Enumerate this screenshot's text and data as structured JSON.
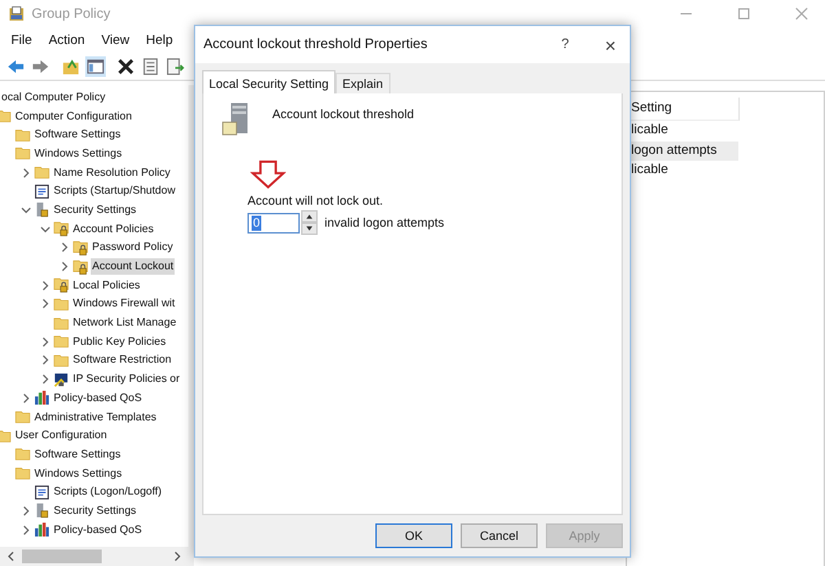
{
  "window": {
    "title": "Group Policy"
  },
  "menu": [
    "File",
    "Action",
    "View",
    "Help"
  ],
  "toolbar": [
    {
      "kind": "back"
    },
    {
      "kind": "forward"
    },
    {
      "kind": "up"
    },
    {
      "kind": "tree",
      "pressed": true
    },
    {
      "kind": "delete"
    },
    {
      "kind": "properties"
    },
    {
      "kind": "export"
    }
  ],
  "tree": [
    {
      "label": "ocal Computer Policy",
      "selected": false,
      "children": [
        {
          "label": "Computer Configuration",
          "kind": "folder",
          "selected": false,
          "children": [
            {
              "label": "Software Settings",
              "kind": "folder",
              "selected": false
            },
            {
              "label": "Windows Settings",
              "kind": "folder",
              "selected": false,
              "children": [
                {
                  "label": "Name Resolution Policy",
                  "kind": "folder",
                  "expanded": false,
                  "selected": false
                },
                {
                  "label": "Scripts (Startup/Shutdow",
                  "kind": "script",
                  "selected": false
                },
                {
                  "label": "Security Settings",
                  "kind": "security",
                  "expanded": true,
                  "selected": false,
                  "children": [
                    {
                      "label": "Account Policies",
                      "kind": "locked",
                      "expanded": true,
                      "selected": false,
                      "children": [
                        {
                          "label": "Password Policy",
                          "kind": "locked",
                          "expanded": false,
                          "selected": false
                        },
                        {
                          "label": "Account Lockout",
                          "kind": "locked",
                          "expanded": false,
                          "selected": true
                        }
                      ]
                    },
                    {
                      "label": "Local Policies",
                      "kind": "locked",
                      "expanded": false,
                      "selected": false
                    },
                    {
                      "label": "Windows Firewall wit",
                      "kind": "folder",
                      "expanded": false,
                      "selected": false
                    },
                    {
                      "label": "Network List Manage",
                      "kind": "folder",
                      "selected": false
                    },
                    {
                      "label": "Public Key Policies",
                      "kind": "folder",
                      "expanded": false,
                      "selected": false
                    },
                    {
                      "label": "Software Restriction",
                      "kind": "folder",
                      "expanded": false,
                      "selected": false
                    },
                    {
                      "label": "IP Security Policies or",
                      "kind": "monitor",
                      "expanded": false,
                      "selected": false
                    }
                  ]
                },
                {
                  "label": "Policy-based QoS",
                  "kind": "chart",
                  "expanded": false,
                  "selected": false
                }
              ]
            },
            {
              "label": "Administrative Templates",
              "kind": "folder",
              "selected": false
            }
          ]
        },
        {
          "label": "User Configuration",
          "kind": "folder",
          "selected": false,
          "children": [
            {
              "label": "Software Settings",
              "kind": "folder",
              "selected": false
            },
            {
              "label": "Windows Settings",
              "kind": "folder",
              "selected": false,
              "children": [
                {
                  "label": "Scripts (Logon/Logoff)",
                  "kind": "script",
                  "selected": false
                },
                {
                  "label": "Security Settings",
                  "kind": "security",
                  "expanded": false,
                  "selected": false
                },
                {
                  "label": "Policy-based QoS",
                  "kind": "chart",
                  "expanded": false,
                  "selected": false
                }
              ]
            }
          ]
        }
      ]
    }
  ],
  "list": {
    "header": "Setting",
    "rows": [
      {
        "text": "licable",
        "selected": false
      },
      {
        "text": "logon attempts",
        "selected": true
      },
      {
        "text": "licable",
        "selected": false
      }
    ]
  },
  "dialog": {
    "title": "Account lockout threshold Properties",
    "help": "?",
    "close": "×",
    "tabs": [
      {
        "label": "Local Security Setting",
        "selected": true
      },
      {
        "label": "Explain",
        "selected": false
      }
    ],
    "heading": "Account lockout threshold",
    "note": "Account will not lock out.",
    "field": {
      "value": "0",
      "value_selected": true,
      "suffix": "invalid logon attempts"
    },
    "buttons": [
      {
        "label": "OK",
        "default": true,
        "disabled": false
      },
      {
        "label": "Cancel",
        "default": false,
        "disabled": false
      },
      {
        "label": "Apply",
        "default": false,
        "disabled": true
      }
    ]
  }
}
